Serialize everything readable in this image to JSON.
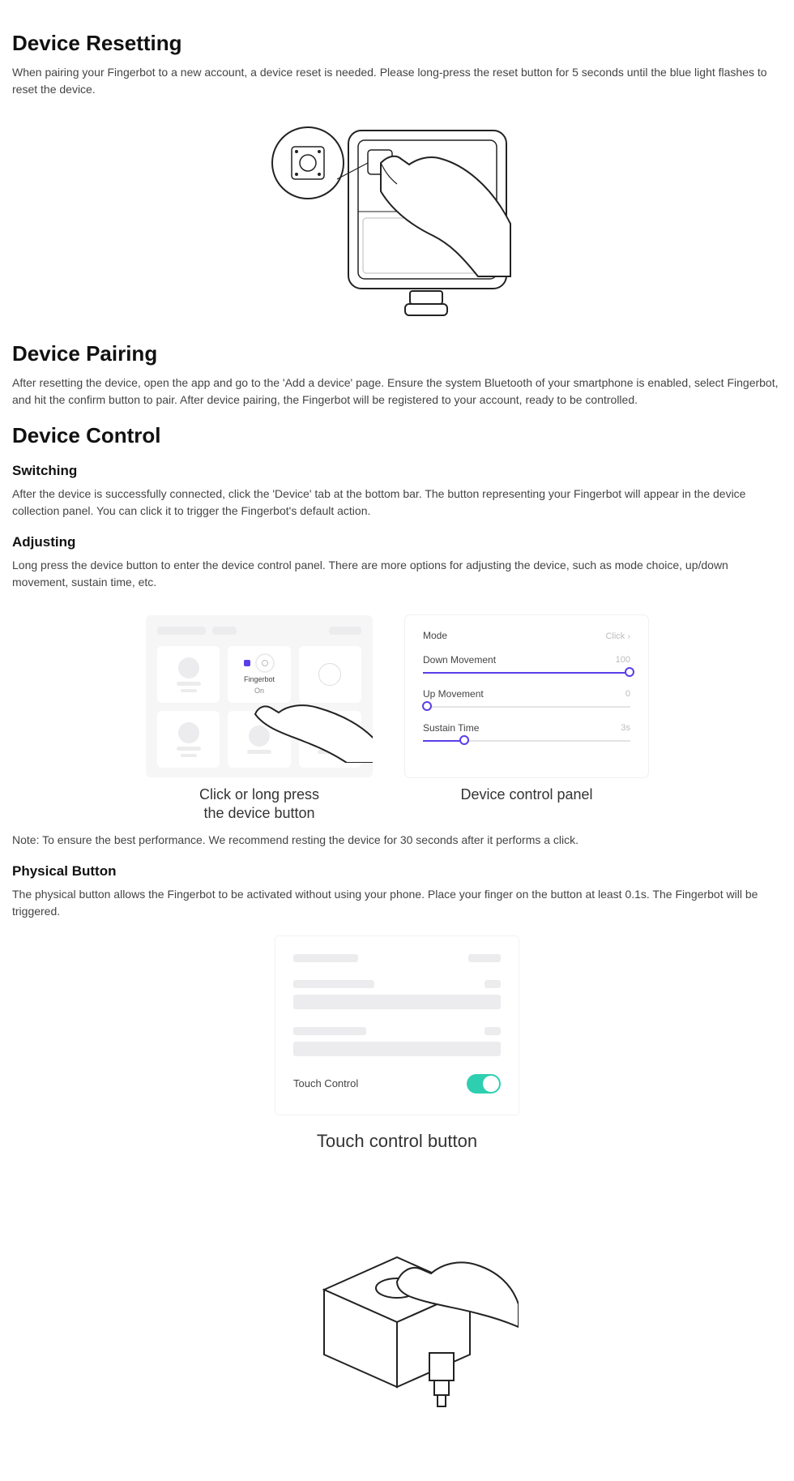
{
  "sections": {
    "reset": {
      "title": "Device Resetting",
      "body": "When pairing your Fingerbot to a new account, a device reset is needed. Please long-press the reset button for 5 seconds until the blue light flashes to reset the device."
    },
    "pairing": {
      "title": "Device Pairing",
      "body": "After resetting the device, open the app and go to the 'Add a device' page. Ensure the system Bluetooth of your smartphone is enabled, select Fingerbot, and hit the confirm button to pair. After device pairing, the Fingerbot will be registered to your account, ready to be controlled."
    },
    "control": {
      "title": "Device Control",
      "switching": {
        "heading": "Switching",
        "body": "After the device is successfully connected, click the 'Device' tab at the bottom bar. The button representing your Fingerbot will appear in the device collection panel. You can click it to trigger the Fingerbot's default action."
      },
      "adjusting": {
        "heading": "Adjusting",
        "body": "Long press the device button to enter the device control panel. There are more options for adjusting the device, such as mode choice, up/down movement, sustain time, etc."
      },
      "figure_left_caption": "Click or long press\nthe device button",
      "figure_right_caption": "Device control panel",
      "note": "Note: To ensure the best performance. We recommend resting the device for 30 seconds after it performs a click.",
      "physical": {
        "heading": "Physical Button",
        "body": "The physical button allows the Fingerbot to be activated without using your phone. Place your finger on the button at least 0.1s. The Fingerbot will be triggered."
      },
      "touch_caption": "Touch control button"
    }
  },
  "app_mock_left": {
    "device_name": "Fingerbot",
    "device_status": "On"
  },
  "control_panel": {
    "mode_label": "Mode",
    "mode_value": "Click",
    "down_label": "Down Movement",
    "down_value": "100",
    "up_label": "Up Movement",
    "up_value": "0",
    "sustain_label": "Sustain Time",
    "sustain_value": "3s"
  },
  "touch_panel": {
    "label": "Touch Control"
  }
}
